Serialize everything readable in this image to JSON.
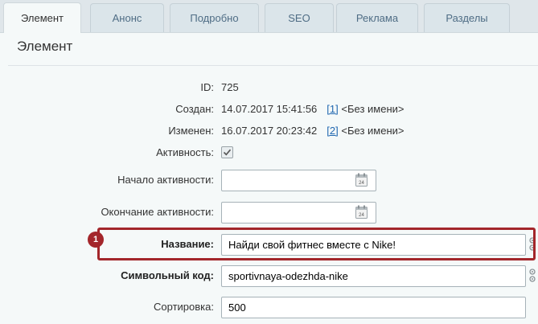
{
  "tabs": [
    {
      "label": "Элемент",
      "active": true
    },
    {
      "label": "Анонс"
    },
    {
      "label": "Подробно"
    },
    {
      "label": "SEO"
    },
    {
      "label": "Реклама"
    },
    {
      "label": "Разделы"
    }
  ],
  "panel": {
    "title": "Элемент"
  },
  "fields": {
    "id": {
      "label": "ID:",
      "value": "725"
    },
    "created": {
      "label": "Создан:",
      "datetime": "14.07.2017 15:41:56",
      "user_link": "[1]",
      "user_name": "<Без имени>"
    },
    "modified": {
      "label": "Изменен:",
      "datetime": "16.07.2017 20:23:42",
      "user_link": "[2]",
      "user_name": "<Без имени>"
    },
    "active": {
      "label": "Активность:",
      "checked": true
    },
    "active_from": {
      "label": "Начало активности:",
      "value": ""
    },
    "active_to": {
      "label": "Окончание активности:",
      "value": ""
    },
    "name": {
      "label": "Название:",
      "value": "Найди свой фитнес вместе с Nike!"
    },
    "code": {
      "label": "Символьный код:",
      "value": "sportivnaya-odezhda-nike"
    },
    "sort": {
      "label": "Сортировка:",
      "value": "500"
    }
  },
  "annotation": {
    "badge": "1",
    "color": "#a3262b"
  },
  "colors": {
    "tab_text": "#4f6d85",
    "link": "#2067b0",
    "panel_bg": "#f5f9f9"
  }
}
